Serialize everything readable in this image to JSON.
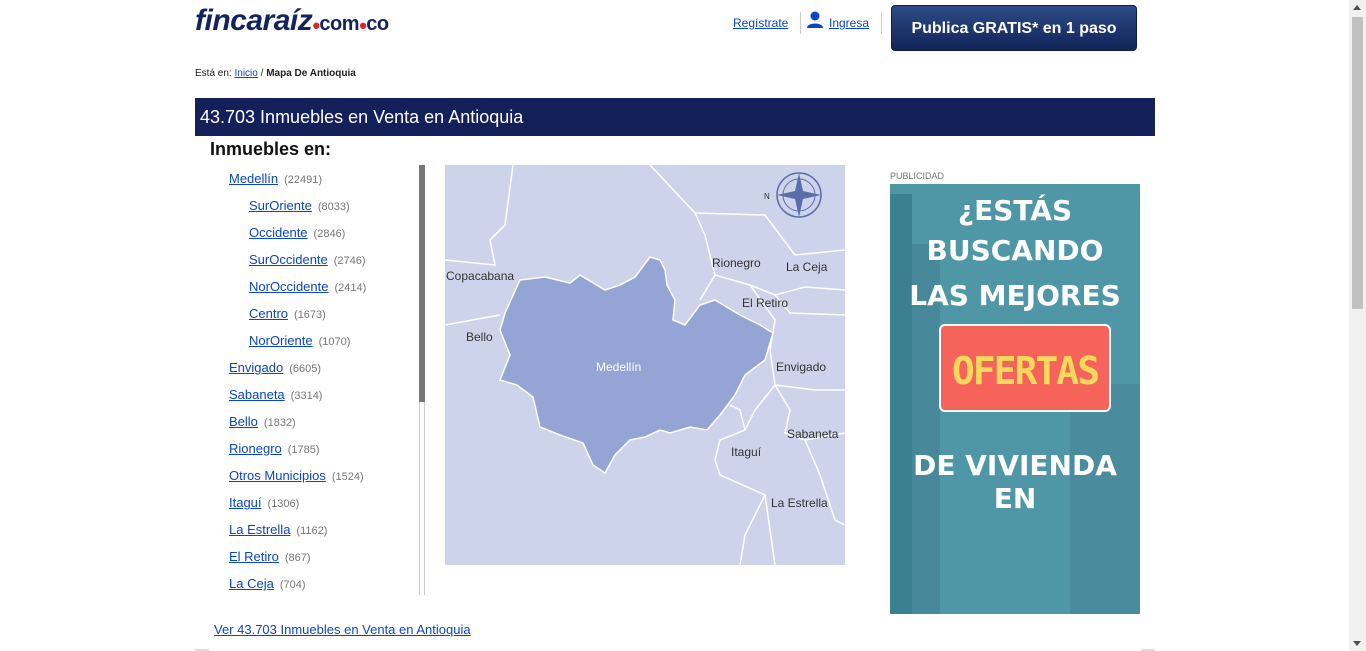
{
  "header": {
    "logo_main": "fincaraíz",
    "logo_com": "com",
    "logo_co": "co",
    "register_label": "Regístrate",
    "login_label": "Ingresa",
    "publish_button": "Publica GRATIS* en 1 paso"
  },
  "breadcrumb": {
    "prefix": "Está en:",
    "home": "Inicio",
    "separator": "/",
    "current": "Mapa De Antioquia"
  },
  "title": "43.703 Inmuebles en Venta en Antioquia",
  "section_heading": "Inmuebles en:",
  "locations": [
    {
      "name": "Medellín",
      "count": "(22491)"
    },
    {
      "name": "SurOriente",
      "count": "(8033)"
    },
    {
      "name": "Occidente",
      "count": "(2846)"
    },
    {
      "name": "SurOccidente",
      "count": "(2746)"
    },
    {
      "name": "NorOccidente",
      "count": "(2414)"
    },
    {
      "name": "Centro",
      "count": "(1673)"
    },
    {
      "name": "NorOriente",
      "count": "(1070)"
    },
    {
      "name": "Envigado",
      "count": "(6605)"
    },
    {
      "name": "Sabaneta",
      "count": "(3314)"
    },
    {
      "name": "Bello",
      "count": "(1832)"
    },
    {
      "name": "Rionegro",
      "count": "(1785)"
    },
    {
      "name": "Otros Municipios",
      "count": "(1524)"
    },
    {
      "name": "Itaguí",
      "count": "(1306)"
    },
    {
      "name": "La Estrella",
      "count": "(1162)"
    },
    {
      "name": "El Retiro",
      "count": "(867)"
    },
    {
      "name": "La Ceja",
      "count": "(704)"
    }
  ],
  "map": {
    "labels": [
      "Copacabana",
      "Rionegro",
      "La Ceja",
      "El Retiro",
      "Bello",
      "Medellín",
      "Envigado",
      "Sabaneta",
      "Itaguí",
      "La Estrella"
    ],
    "compass_letter": "N",
    "region_color": "#94a4d4",
    "background_color": "#cdd3ea"
  },
  "ad": {
    "label": "PUBLICIDAD",
    "line1": "¿ESTÁS",
    "line2": "BUSCANDO",
    "line3": "LAS MEJORES",
    "tag": "OFERTAS",
    "line4": "DE VIVIENDA EN"
  },
  "footer_link": "Ver 43.703 Inmuebles en Venta en Antioquia",
  "colors": {
    "brand_navy": "#14205a",
    "link": "#0b44c9",
    "logo_red": "#d7272c"
  }
}
